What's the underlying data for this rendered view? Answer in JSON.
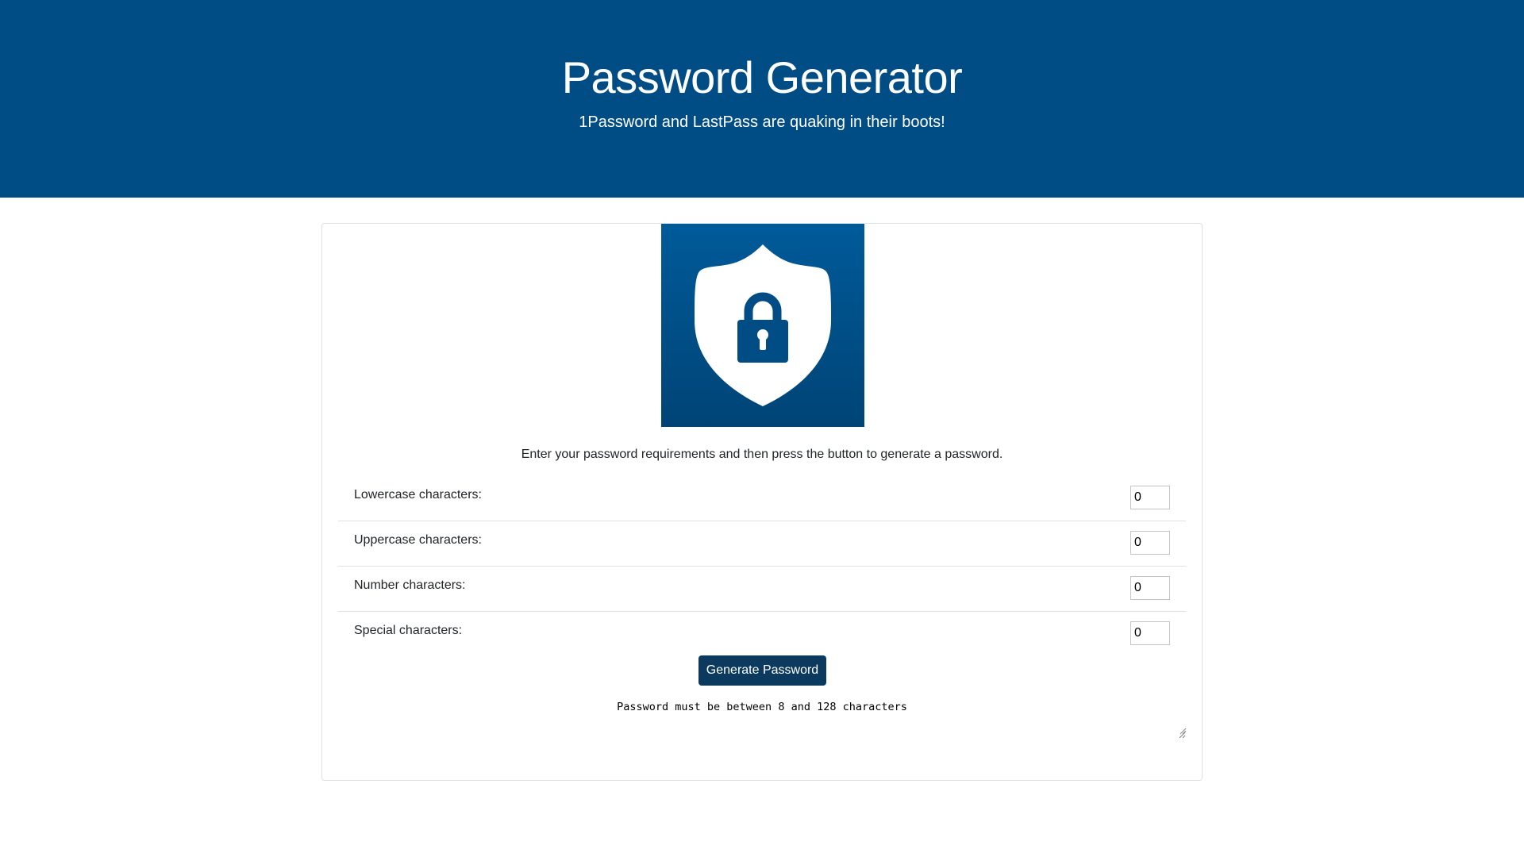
{
  "header": {
    "title": "Password Generator",
    "subtitle": "1Password and LastPass are quaking in their boots!",
    "background_color": "#004d86"
  },
  "card": {
    "image_icon": "shield-lock-icon",
    "instructions": "Enter your password requirements and then press the button to generate a password.",
    "fields": [
      {
        "label": "Lowercase characters:",
        "value": "0"
      },
      {
        "label": "Uppercase characters:",
        "value": "0"
      },
      {
        "label": "Number characters:",
        "value": "0"
      },
      {
        "label": "Special characters:",
        "value": "0"
      }
    ],
    "generate_button_label": "Generate Password",
    "button_color": "#0b3a5e",
    "output_text": "Password must be between 8 and 128 characters"
  }
}
